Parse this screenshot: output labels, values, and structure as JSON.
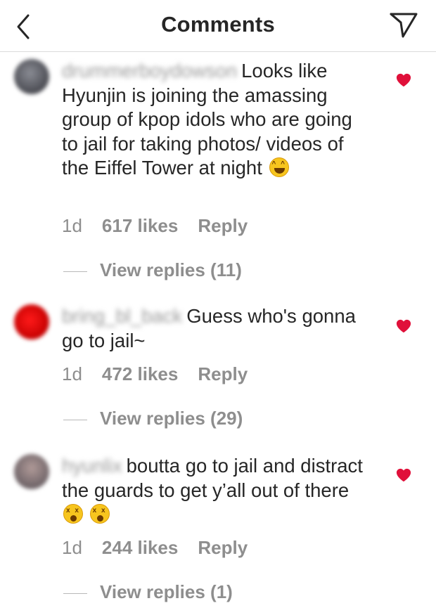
{
  "header": {
    "title": "Comments",
    "back_icon": "chevron-left-icon",
    "share_icon": "paper-plane-icon"
  },
  "colors": {
    "heart": "#e0103a",
    "meta_gray": "#8e8e8e",
    "text": "#262626"
  },
  "comments": [
    {
      "username": "drummerboydowson",
      "text": "Looks like Hyunjin is joining the amassing group of kpop idols who are going to jail for taking photos/ videos of the Eiffel Tower at night",
      "emoji": "😂",
      "time": "1d",
      "likes": "617 likes",
      "reply": "Reply",
      "view_replies": "View replies (11)",
      "liked": true
    },
    {
      "username": "bring_bl_back",
      "text": "Guess who's gonna go to jail~",
      "time": "1d",
      "likes": "472 likes",
      "reply": "Reply",
      "view_replies": "View replies (29)",
      "liked": true
    },
    {
      "username": "hyunlix",
      "text": "boutta go to jail and distract the guards to get y’all out of there",
      "emoji": "😵😵",
      "time": "1d",
      "likes": "244 likes",
      "reply": "Reply",
      "view_replies": "View replies (1)",
      "liked": true
    }
  ]
}
